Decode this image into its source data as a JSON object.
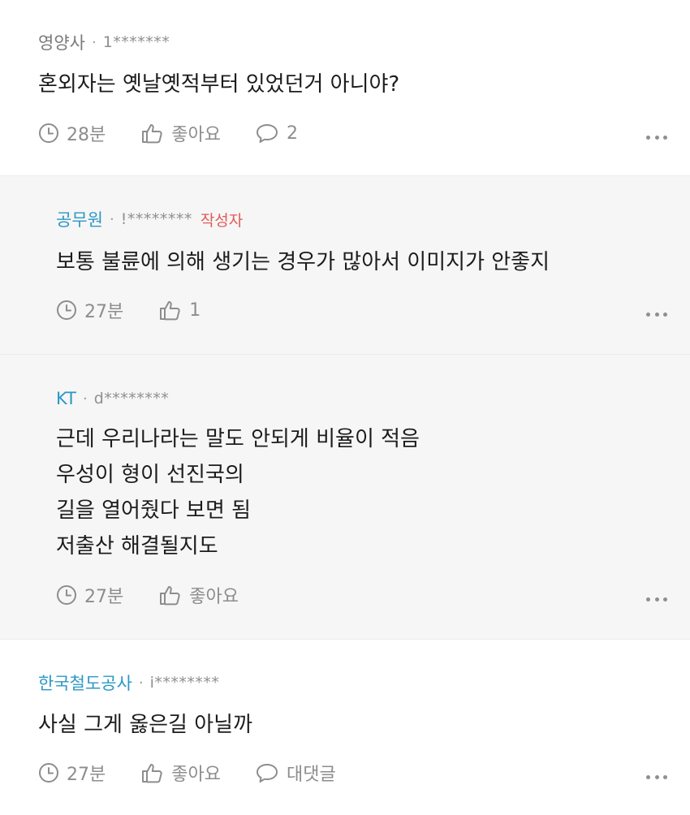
{
  "comments": [
    {
      "author": "영양사",
      "uid": "1*******",
      "text": "혼외자는 옛날옛적부터 있었던거 아니야?",
      "time": "28분",
      "like": "좋아요",
      "reply": "2"
    },
    {
      "author": "공무원",
      "uid": "!********",
      "writer_badge": "작성자",
      "text": "보통 불륜에 의해 생기는 경우가 많아서 이미지가 안좋지",
      "time": "27분",
      "like": "1"
    },
    {
      "author": "KT",
      "uid": "d********",
      "text": "근데 우리나라는 말도 안되게 비율이 적음\n우성이 형이 선진국의\n길을 열어줬다 보면 됨\n저출산 해결될지도",
      "time": "27분",
      "like": "좋아요"
    },
    {
      "author": "한국철도공사",
      "uid": "i********",
      "text": "사실 그게 옳은길 아닐까",
      "time": "27분",
      "like": "좋아요",
      "reply": "대댓글"
    }
  ],
  "colors": {
    "author_blue": "#2b98c4",
    "writer_badge": "#e15a5a",
    "reply_background": "#f6f6f6"
  },
  "icons": [
    "clock-icon",
    "thumbs-up-icon",
    "speech-bubble-icon",
    "more-dots-icon"
  ]
}
